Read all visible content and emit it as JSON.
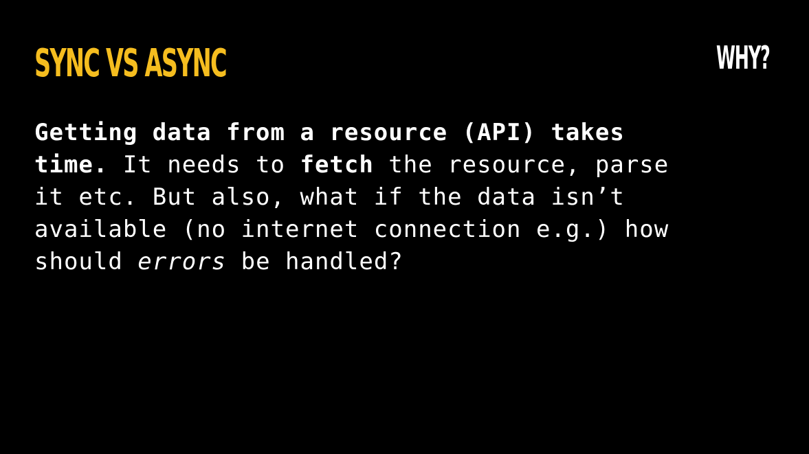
{
  "slide": {
    "title": "SYNC VS ASYNC",
    "tag": "WHY?",
    "body": {
      "line1": {
        "bold": "Getting data from a resource (API) takes"
      },
      "line2": {
        "bold_a": "time.",
        "text_a": " It needs to ",
        "bold_b": "fetch",
        "text_b": " the resource, parse"
      },
      "line3": {
        "text": "it etc. But also, what if the data isn’t"
      },
      "line4": {
        "text": "available (no internet connection e.g.) how"
      },
      "line5": {
        "text_a": "should ",
        "italic": "errors",
        "text_b": " be handled?"
      }
    }
  },
  "colors": {
    "background": "#000000",
    "title": "#f5bd1f",
    "text": "#ffffff"
  }
}
